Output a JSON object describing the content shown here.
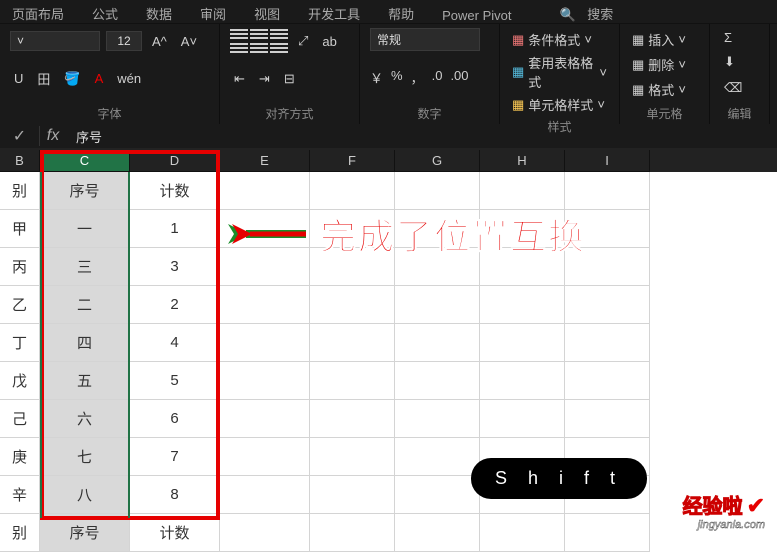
{
  "ribbon": {
    "tabs": [
      "页面布局",
      "公式",
      "数据",
      "审阅",
      "视图",
      "开发工具",
      "帮助",
      "Power Pivot",
      "搜索"
    ],
    "font": {
      "size": "12",
      "group_label": "字体",
      "aa_up": "A^",
      "aa_dn": "A˅",
      "underline": "U",
      "border": "田",
      "fill": "⯀",
      "color": "A",
      "wen": "wén"
    },
    "align": {
      "group_label": "对齐方式",
      "wrap": "ab",
      "merge": "⊟"
    },
    "number": {
      "preset": "常规",
      "group_label": "数字",
      "currency": "￥",
      "percent": "%",
      "comma": "，",
      "inc": ".0",
      "dec": ".00"
    },
    "styles": {
      "cond": "条件格式",
      "tblfmt": "套用表格格式",
      "cellfmt": "单元格样式",
      "group_label": "样式"
    },
    "cells": {
      "insert": "插入",
      "delete": "删除",
      "format": "格式",
      "group_label": "单元格"
    },
    "editing": {
      "sum": "Σ",
      "fill": "⬇",
      "clear": "⌫",
      "group_label": "编辑"
    }
  },
  "formula_bar": {
    "check": "✓",
    "fx": "fx",
    "value": "序号"
  },
  "columns": {
    "B": "B",
    "C": "C",
    "D": "D",
    "E": "E",
    "F": "F",
    "G": "G",
    "H": "H",
    "I": "I"
  },
  "grid": {
    "headers": {
      "b": "别",
      "c": "序号",
      "d": "计数"
    },
    "rows": [
      {
        "b": "甲",
        "c": "一",
        "d": "1"
      },
      {
        "b": "丙",
        "c": "三",
        "d": "3"
      },
      {
        "b": "乙",
        "c": "二",
        "d": "2"
      },
      {
        "b": "丁",
        "c": "四",
        "d": "4"
      },
      {
        "b": "戊",
        "c": "五",
        "d": "5"
      },
      {
        "b": "己",
        "c": "六",
        "d": "6"
      },
      {
        "b": "庚",
        "c": "七",
        "d": "7"
      },
      {
        "b": "辛",
        "c": "八",
        "d": "8"
      }
    ]
  },
  "annotation": "完成了位置互换",
  "shift_badge": "S h i f t",
  "watermark": {
    "cn": "经验啦",
    "url": "jingyanla.com"
  },
  "widths": {
    "B": 40,
    "C": 90,
    "D": 90,
    "E": 90,
    "F": 85,
    "G": 85,
    "H": 85,
    "I": 85
  }
}
